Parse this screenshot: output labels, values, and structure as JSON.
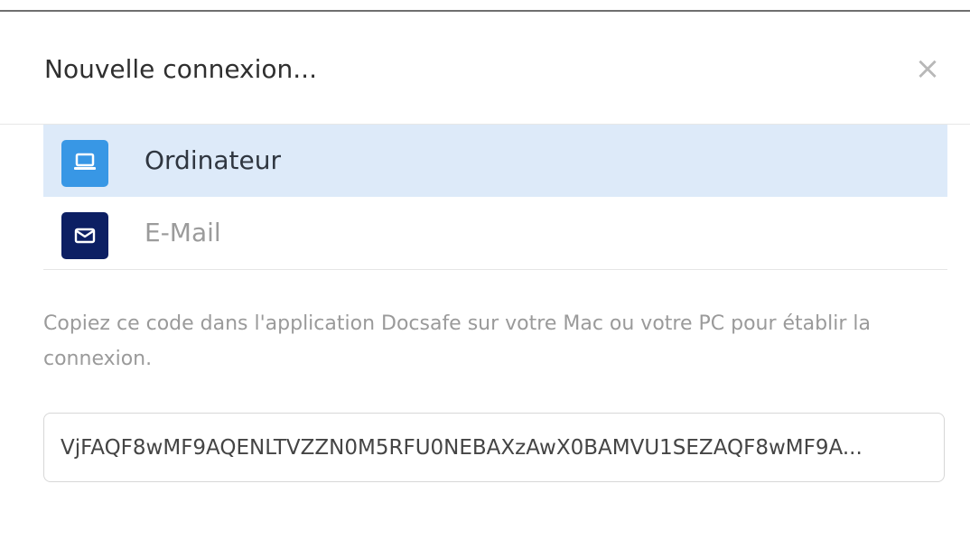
{
  "dialog": {
    "title": "Nouvelle connexion...",
    "close_icon": "close-icon",
    "close_glyph": "×",
    "menu": [
      {
        "label": "Ordinateur",
        "icon": "laptop-icon",
        "icon_color": "#3897e5",
        "selected": true
      },
      {
        "label": "E-Mail",
        "icon": "mail-icon",
        "icon_color": "#0c1f63",
        "selected": false
      }
    ],
    "description": "Copiez ce code dans l'application Docsafe sur votre Mac ou votre PC pour établir la connexion.",
    "code": "VjFAQF8wMF9AQENLTVZZN0M5RFU0NEBAXzAwX0BAMVU1SEZAQF8wMF9A..."
  },
  "colors": {
    "selected_row": "#ddeaf9",
    "title_text": "#2f2f2f",
    "muted_text": "#9a9a9a",
    "divider": "#e6e6e6"
  }
}
